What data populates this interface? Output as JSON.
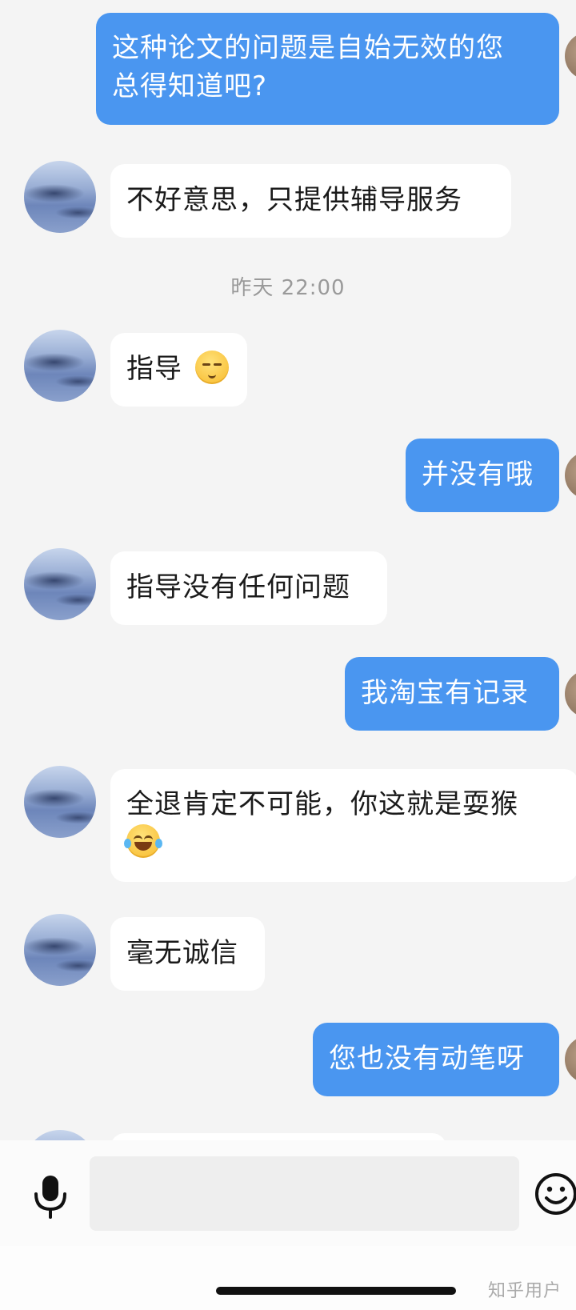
{
  "messages": [
    {
      "side": "out",
      "lines": [
        "这种论文的问题是自始无效的您",
        "总得知道吧?"
      ]
    },
    {
      "side": "in",
      "text": "不好意思，只提供辅导服务"
    },
    {
      "side": "in",
      "text": "指导",
      "emoji": "relieved-face-emoji"
    },
    {
      "side": "out",
      "text": "并没有哦"
    },
    {
      "side": "in",
      "text": "指导没有任何问题"
    },
    {
      "side": "out",
      "text": "我淘宝有记录"
    },
    {
      "side": "in",
      "lines": [
        "全退肯定不可能，你这就是耍猴"
      ],
      "emoji": "tears-of-joy-emoji"
    },
    {
      "side": "in",
      "text": "毫无诚信"
    },
    {
      "side": "out",
      "text": "您也没有动笔呀"
    }
  ],
  "timestamp": "昨天 22:00",
  "input_bar": {
    "mic_icon": "microphone-icon",
    "emoji_icon": "smiley-icon",
    "placeholder": ""
  },
  "watermark": "知乎用户",
  "colors": {
    "outgoing_bubble": "#4a96f0",
    "incoming_bubble": "#ffffff",
    "background": "#f4f4f4"
  }
}
